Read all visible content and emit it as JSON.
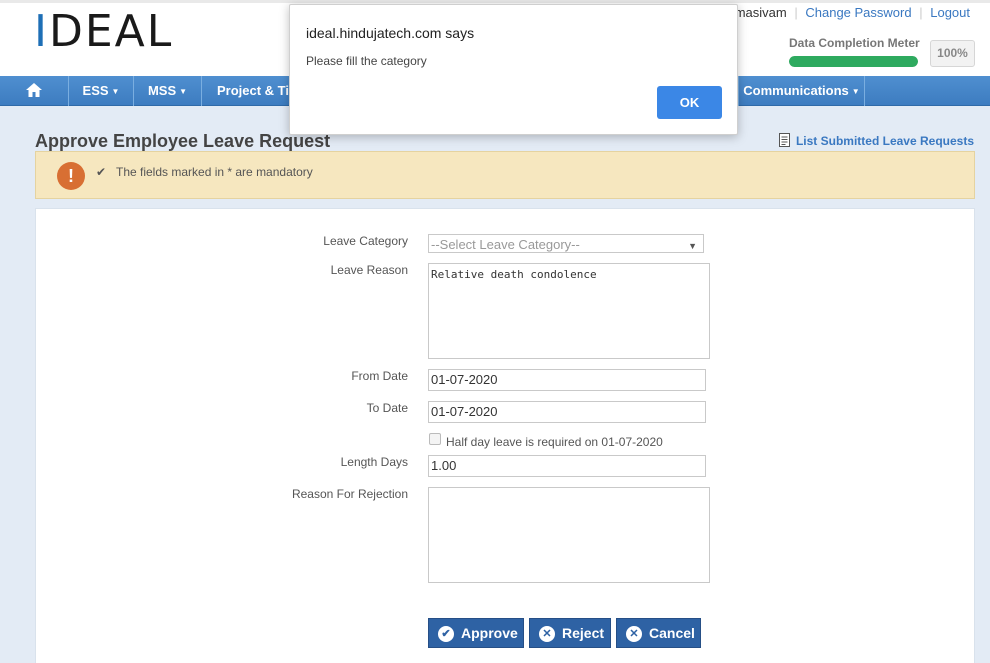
{
  "header": {
    "logo_text_1": "I",
    "logo_text_2": "DEAL",
    "user_name_fragment": "aramasivam",
    "change_password": "Change Password",
    "logout": "Logout",
    "meter_label": "Data Completion Meter",
    "meter_value_text": "100%",
    "meter_fraction": 1.0
  },
  "nav": {
    "items": [
      {
        "label": "ESS"
      },
      {
        "label": "MSS"
      },
      {
        "label": "Project & Ti"
      },
      {
        "label": "Communications"
      }
    ]
  },
  "page": {
    "title": "Approve Employee Leave Request",
    "list_link": "List Submitted Leave Requests"
  },
  "alert": {
    "text": "The fields marked in * are mandatory"
  },
  "form": {
    "leave_category_label": "Leave Category",
    "leave_category_placeholder": "--Select Leave Category--",
    "leave_reason_label": "Leave Reason",
    "leave_reason_value": "Relative death condolence",
    "from_date_label": "From Date",
    "from_date_value": "01-07-2020",
    "to_date_label": "To Date",
    "to_date_value": "01-07-2020",
    "half_day_label": "Half day leave is required on 01-07-2020",
    "length_days_label": "Length Days",
    "length_days_value": "1.00",
    "rejection_label": "Reason For Rejection",
    "rejection_value": ""
  },
  "buttons": {
    "approve": "Approve",
    "reject": "Reject",
    "cancel": "Cancel"
  },
  "dialog": {
    "title": "ideal.hindujatech.com says",
    "message": "Please fill the category",
    "ok": "OK"
  },
  "colors": {
    "nav": "#3d7cc0",
    "button": "#2e62a4",
    "meter": "#2eaa5f",
    "dialog_ok": "#3b87e6"
  }
}
